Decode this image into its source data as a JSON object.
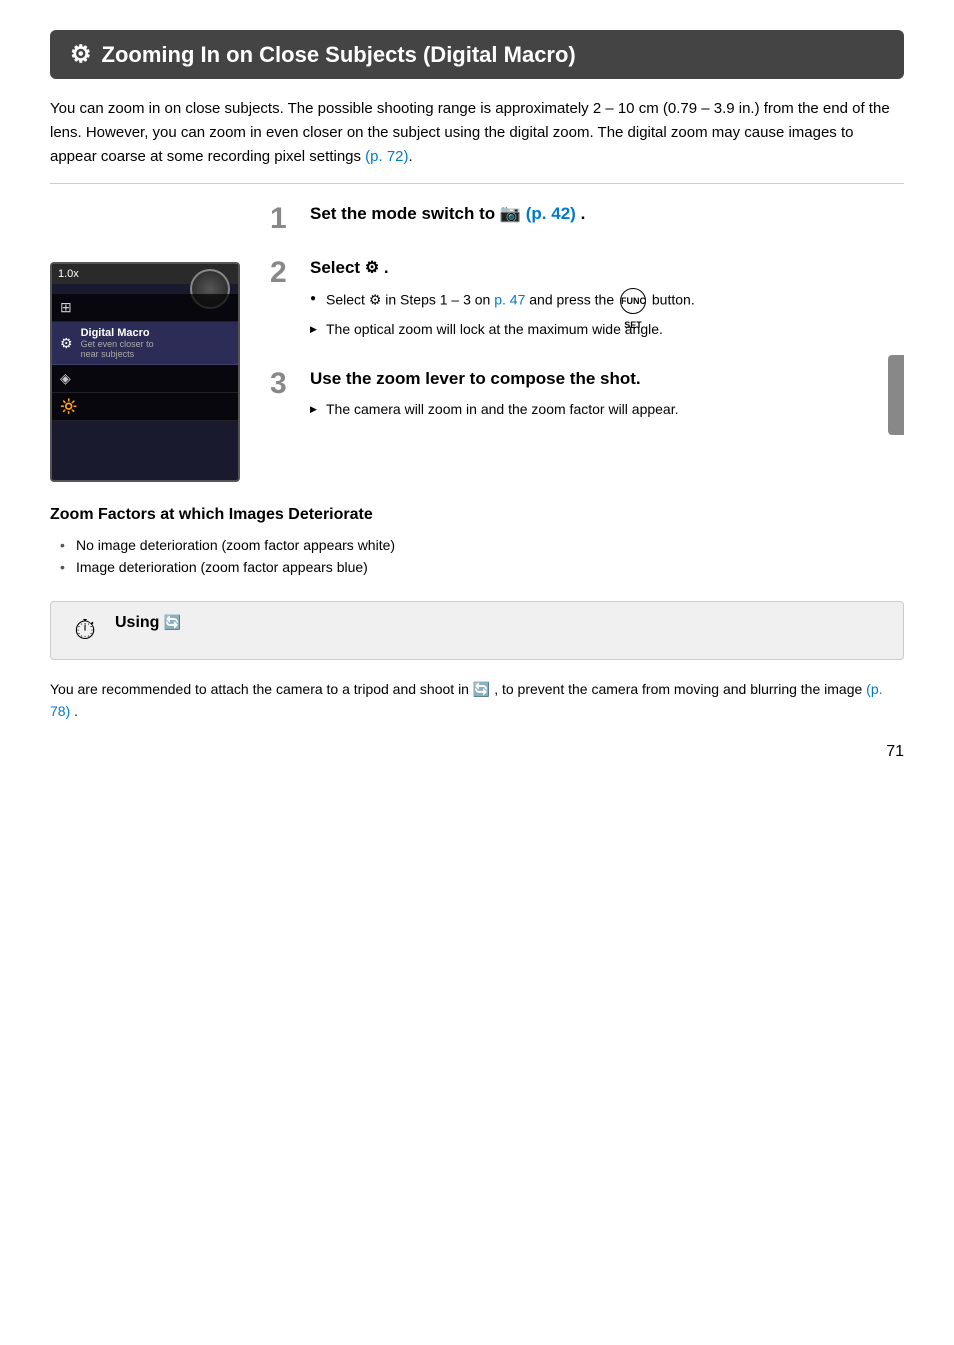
{
  "header": {
    "icon": "⚙",
    "title": "Zooming In on Close Subjects (Digital Macro)"
  },
  "intro": {
    "text1": "You can zoom in on close subjects. The possible shooting range is approximately 2 – 10 cm (0.79 – 3.9 in.) from the end of the lens. However, you can zoom in even closer on the subject using the digital zoom. The digital zoom may cause images to appear coarse at some recording pixel settings ",
    "link1": "(p. 72)",
    "text2": "."
  },
  "steps": [
    {
      "number": "1",
      "title_start": "Set the mode switch to ",
      "title_icon": "📷",
      "title_end_link": "(p. 42)",
      "title_after": ".",
      "bullets": []
    },
    {
      "number": "2",
      "title_start": "Select ",
      "title_icon": "⚙",
      "title_end": ".",
      "bullets": [
        {
          "type": "circle",
          "text_start": "Select ",
          "icon": "⚙",
          "text_mid": " in Steps 1 – 3 on ",
          "link": "p. 47",
          "text_end": " and press the",
          "btn": "FUNC SET",
          "text_after": "button."
        },
        {
          "type": "triangle",
          "text": "The optical zoom will lock at the maximum wide angle."
        }
      ]
    },
    {
      "number": "3",
      "title": "Use the zoom lever to compose the shot.",
      "bullets": [
        {
          "type": "triangle",
          "text": "The camera will zoom in and the zoom factor will appear."
        }
      ]
    }
  ],
  "zoom_factors": {
    "title": "Zoom Factors at which Images Deteriorate",
    "items": [
      "No image deterioration (zoom factor appears white)",
      "Image deterioration (zoom factor appears blue)"
    ]
  },
  "info_box": {
    "icon": "⏱",
    "title_start": "Using ",
    "title_icon": "🔄",
    "body_start": "You are recommended to attach the camera to a tripod and shoot in ",
    "body_icon": "🔄",
    "body_mid": ", to prevent the camera from moving and blurring the image ",
    "body_link": "(p. 78)",
    "body_end": "."
  },
  "camera": {
    "zoom": "1.0x",
    "menu_items": [
      {
        "icon": "⊞",
        "label": ""
      },
      {
        "icon": "⚙",
        "label": "Digital Macro",
        "sublabel": "Get even closer to near subjects",
        "selected": true
      },
      {
        "icon": "◈",
        "label": ""
      },
      {
        "icon": "🔆",
        "label": ""
      }
    ]
  },
  "page_number": "71"
}
